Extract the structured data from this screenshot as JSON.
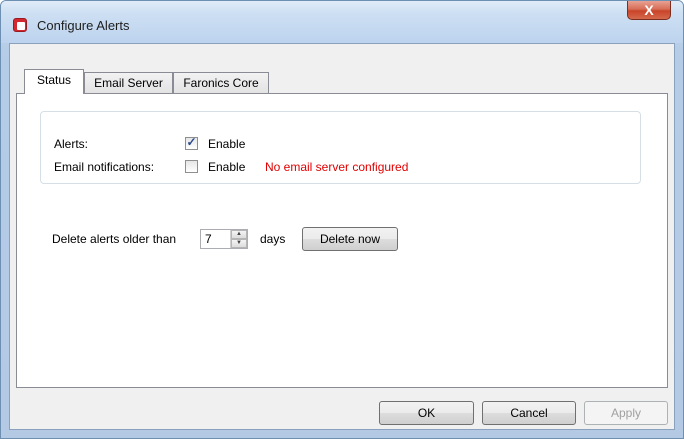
{
  "window": {
    "title": "Configure Alerts",
    "close_label": "X",
    "app_icon": "faronics-app-icon"
  },
  "tabs": [
    {
      "label": "Status",
      "active": true
    },
    {
      "label": "Email Server",
      "active": false
    },
    {
      "label": "Faronics Core",
      "active": false
    }
  ],
  "status": {
    "alerts": {
      "label": "Alerts:",
      "checkbox_label": "Enable",
      "checked": true
    },
    "email_notifications": {
      "label": "Email notifications:",
      "checkbox_label": "Enable",
      "checked": false,
      "warning": "No email server configured",
      "warning_color": "#e00000"
    },
    "delete": {
      "label": "Delete alerts older than",
      "value": "7",
      "unit": "days",
      "button_label": "Delete now"
    }
  },
  "footer": {
    "ok_label": "OK",
    "cancel_label": "Cancel",
    "apply_label": "Apply",
    "apply_enabled": false
  }
}
